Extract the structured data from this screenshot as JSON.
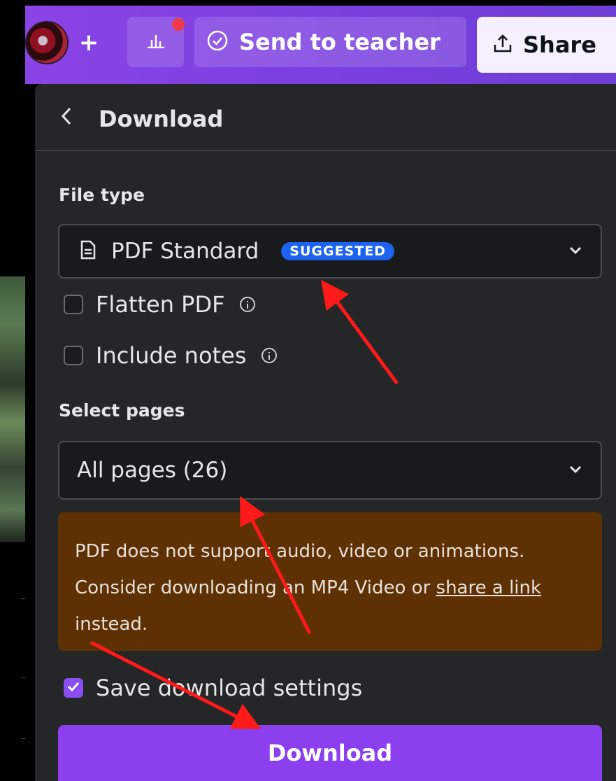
{
  "topbar": {
    "add_label": "+",
    "send_label": "Send to teacher",
    "share_label": "Share"
  },
  "panel": {
    "title": "Download",
    "file_type_label": "File type",
    "file_type_value": "PDF Standard",
    "suggested_badge": "SUGGESTED",
    "flatten_label": "Flatten PDF",
    "flatten_checked": false,
    "notes_label": "Include notes",
    "notes_checked": false,
    "select_pages_label": "Select pages",
    "pages_value": "All pages (26)",
    "warning_text_1": "PDF does not support audio, video or animations. Consider downloading an MP4 Video or ",
    "warning_link": "share a link",
    "warning_text_2": " instead.",
    "save_settings_label": "Save download settings",
    "save_settings_checked": true,
    "download_button": "Download"
  },
  "icons": [
    "avatar",
    "plus-icon",
    "chart-icon",
    "check-circle-icon",
    "share-upload-icon",
    "chevron-left-icon",
    "document-icon",
    "chevron-down-icon",
    "info-icon",
    "checkmark-icon"
  ],
  "colors": {
    "topbar_gradient_start": "#8a43e6",
    "topbar_gradient_end": "#6d3ed6",
    "panel_bg": "#252627",
    "badge_blue": "#1c63f0",
    "warning_bg": "#5e3104",
    "download_button": "#8b3fef",
    "annotation_arrow": "#ff1a1a",
    "notification_dot": "#f03a4a"
  }
}
